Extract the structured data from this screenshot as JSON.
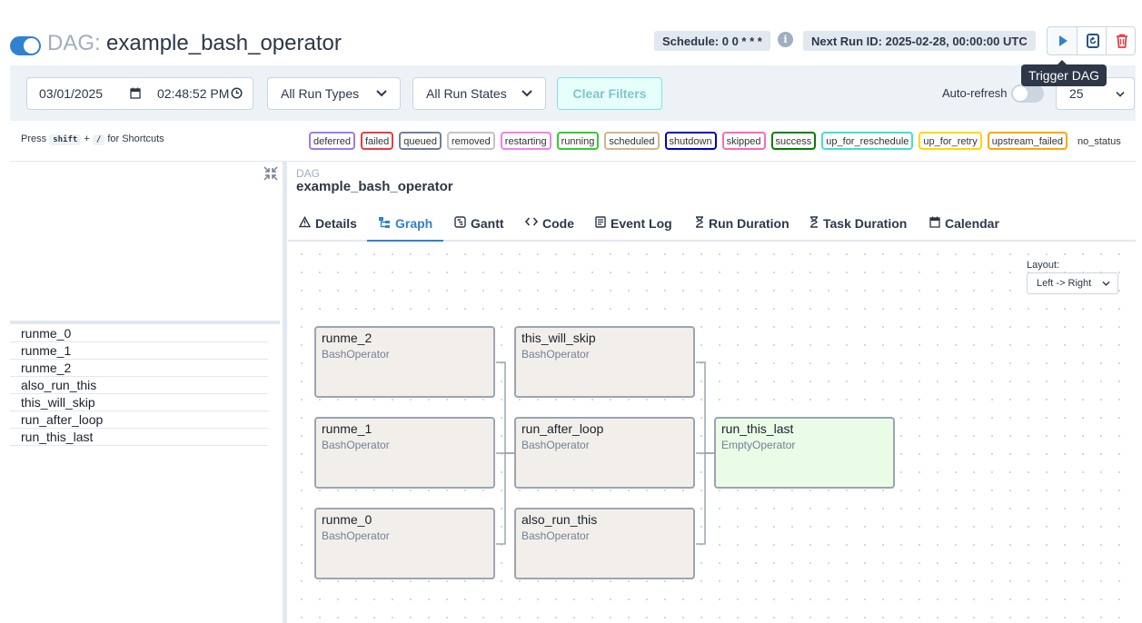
{
  "header": {
    "title_prefix": "DAG:",
    "dag_name": "example_bash_operator",
    "schedule": "Schedule: 0 0 * * *",
    "info_glyph": "i",
    "next_run": "Next Run ID: 2025-02-28, 00:00:00 UTC",
    "tooltip": "Trigger DAG",
    "dag_enabled": true,
    "accent_color": "#3182ce"
  },
  "filters": {
    "date": "03/01/2025",
    "time": "02:48:52 PM",
    "run_types": "All Run Types",
    "run_states": "All Run States",
    "clear_label": "Clear Filters",
    "autorefresh_label": "Auto-refresh",
    "autorefresh_on": false,
    "num_runs": "25"
  },
  "shortcuts": {
    "press": "Press",
    "key1": "shift",
    "plus": "+",
    "key2": "/",
    "suffix": "for Shortcuts"
  },
  "states": [
    {
      "label": "deferred",
      "color": "#9f7aea"
    },
    {
      "label": "failed",
      "color": "#e53e3e"
    },
    {
      "label": "queued",
      "color": "#718096"
    },
    {
      "label": "removed",
      "color": "#c4c4c4"
    },
    {
      "label": "restarting",
      "color": "#ee82ee"
    },
    {
      "label": "running",
      "color": "#32cd32"
    },
    {
      "label": "scheduled",
      "color": "#d2b48c"
    },
    {
      "label": "shutdown",
      "color": "#0000cd"
    },
    {
      "label": "skipped",
      "color": "#ff69b4"
    },
    {
      "label": "success",
      "color": "#008000"
    },
    {
      "label": "up_for_reschedule",
      "color": "#40e0d0"
    },
    {
      "label": "up_for_retry",
      "color": "#ffd700"
    },
    {
      "label": "upstream_failed",
      "color": "#ffa500"
    },
    {
      "label": "no_status",
      "color": "transparent"
    }
  ],
  "tasks": [
    "runme_0",
    "runme_1",
    "runme_2",
    "also_run_this",
    "this_will_skip",
    "run_after_loop",
    "run_this_last"
  ],
  "details": {
    "dag_label": "DAG",
    "dag_id": "example_bash_operator"
  },
  "tabs": [
    {
      "label": "Details",
      "icon": "warning-icon"
    },
    {
      "label": "Graph",
      "icon": "graph-icon"
    },
    {
      "label": "Gantt",
      "icon": "gantt-icon"
    },
    {
      "label": "Code",
      "icon": "code-icon"
    },
    {
      "label": "Event Log",
      "icon": "event-log-icon"
    },
    {
      "label": "Run Duration",
      "icon": "hourglass-icon"
    },
    {
      "label": "Task Duration",
      "icon": "hourglass-icon"
    },
    {
      "label": "Calendar",
      "icon": "calendar-icon"
    }
  ],
  "active_tab": "Graph",
  "graph": {
    "layout_label": "Layout:",
    "layout_value": "Left -> Right",
    "nodes": [
      {
        "name": "runme_2",
        "op": "BashOperator"
      },
      {
        "name": "runme_1",
        "op": "BashOperator"
      },
      {
        "name": "runme_0",
        "op": "BashOperator"
      },
      {
        "name": "this_will_skip",
        "op": "BashOperator"
      },
      {
        "name": "run_after_loop",
        "op": "BashOperator"
      },
      {
        "name": "also_run_this",
        "op": "BashOperator"
      },
      {
        "name": "run_this_last",
        "op": "EmptyOperator"
      }
    ]
  }
}
